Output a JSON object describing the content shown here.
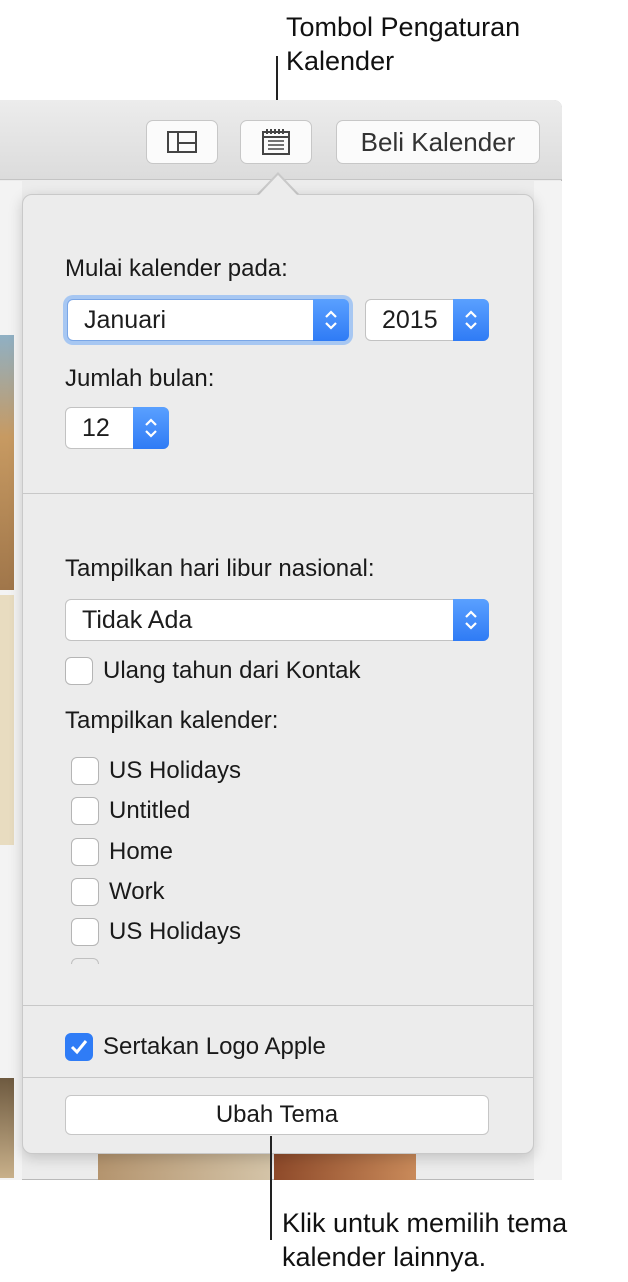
{
  "callouts": {
    "top_line1": "Tombol Pengaturan",
    "top_line2": "Kalender",
    "bottom_line1": "Klik untuk memilih tema",
    "bottom_line2": "kalender lainnya."
  },
  "toolbar": {
    "buy_label": "Beli Kalender",
    "view_icon": "layout-icon",
    "settings_icon": "calendar-settings-icon"
  },
  "popover": {
    "start_label": "Mulai kalender pada:",
    "month_value": "Januari",
    "year_value": "2015",
    "months_label": "Jumlah bulan:",
    "months_value": "12",
    "holidays_label": "Tampilkan hari libur nasional:",
    "holidays_value": "Tidak Ada",
    "birthdays_label": "Ulang tahun dari Kontak",
    "calendars_label": "Tampilkan kalender:",
    "calendars": [
      "US Holidays",
      "Untitled",
      "Home",
      "Work",
      "US Holidays"
    ],
    "apple_logo_label": "Sertakan Logo Apple",
    "apple_logo_checked": true,
    "theme_button": "Ubah Tema"
  },
  "colors": {
    "accent": "#2f7cf6",
    "focus_ring": "#a7c7f2"
  }
}
